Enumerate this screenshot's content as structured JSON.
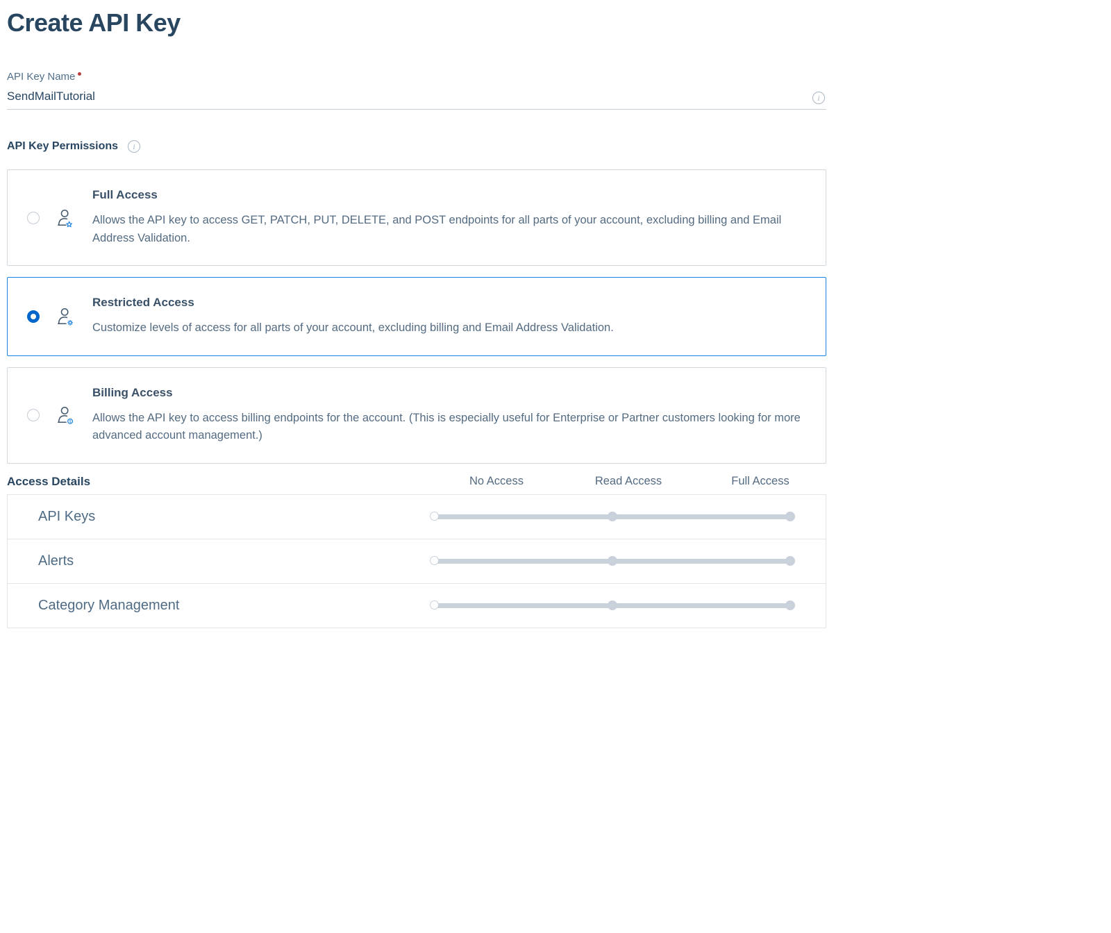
{
  "page": {
    "title": "Create API Key"
  },
  "nameField": {
    "label": "API Key Name",
    "value": "SendMailTutorial"
  },
  "permissions": {
    "label": "API Key Permissions",
    "options": [
      {
        "id": "full",
        "title": "Full Access",
        "desc": "Allows the API key to access GET, PATCH, PUT, DELETE, and POST endpoints for all parts of your account, excluding billing and Email Address Validation.",
        "selected": false,
        "iconAccent": "#1a82e2",
        "iconGlyph": "star"
      },
      {
        "id": "restricted",
        "title": "Restricted Access",
        "desc": "Customize levels of access for all parts of your account, excluding billing and Email Address Validation.",
        "selected": true,
        "iconAccent": "#1a82e2",
        "iconGlyph": "gear"
      },
      {
        "id": "billing",
        "title": "Billing Access",
        "desc": "Allows the API key to access billing endpoints for the account. (This is especially useful for Enterprise or Partner customers looking for more advanced account management.)",
        "selected": false,
        "iconAccent": "#1a82e2",
        "iconGlyph": "dollar"
      }
    ]
  },
  "accessDetails": {
    "heading": "Access Details",
    "columns": [
      "No Access",
      "Read Access",
      "Full Access"
    ],
    "rows": [
      {
        "label": "API Keys",
        "level": 0
      },
      {
        "label": "Alerts",
        "level": 0
      },
      {
        "label": "Category Management",
        "level": 0
      }
    ]
  }
}
